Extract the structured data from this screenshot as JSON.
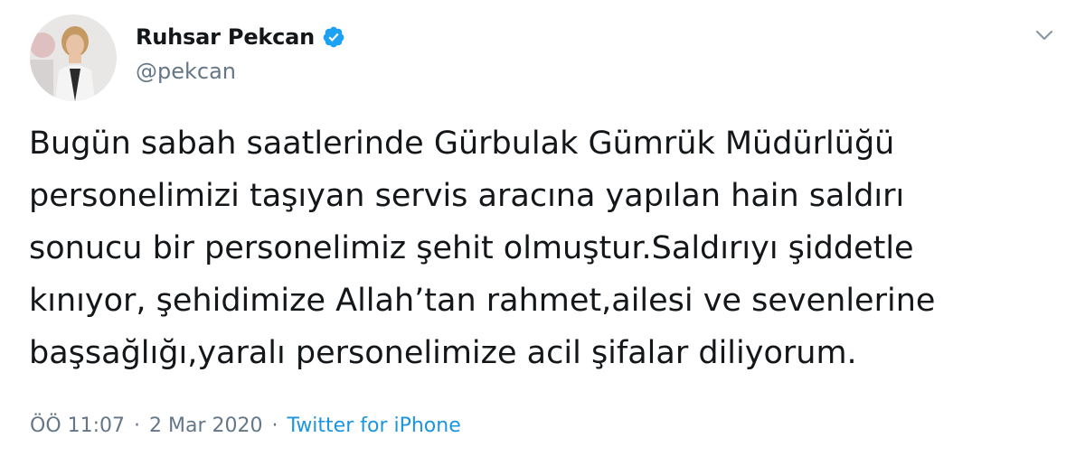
{
  "author": {
    "display_name": "Ruhsar Pekcan",
    "handle": "@pekcan",
    "verified_icon": "verified-badge-icon",
    "avatar_icon": "profile-photo"
  },
  "tweet": {
    "lines": [
      "Bugün sabah saatlerinde Gürbulak Gümrük Müdürlüğü",
      "personelimizi taşıyan servis aracına yapılan hain saldırı",
      "sonucu bir personelimiz şehit olmuştur.Saldırıyı şiddetle",
      "kınıyor, şehidimize Allah’tan rahmet,ailesi ve sevenlerine",
      "başsağlığı,yaralı personelimize acil şifalar diliyorum."
    ]
  },
  "meta": {
    "time": "ÖÖ 11:07",
    "separator": "·",
    "date": "2 Mar 2020",
    "source": "Twitter for iPhone"
  },
  "colors": {
    "text": "#14171a",
    "secondary": "#657786",
    "link": "#1b95e0",
    "verified": "#1da1f2"
  }
}
